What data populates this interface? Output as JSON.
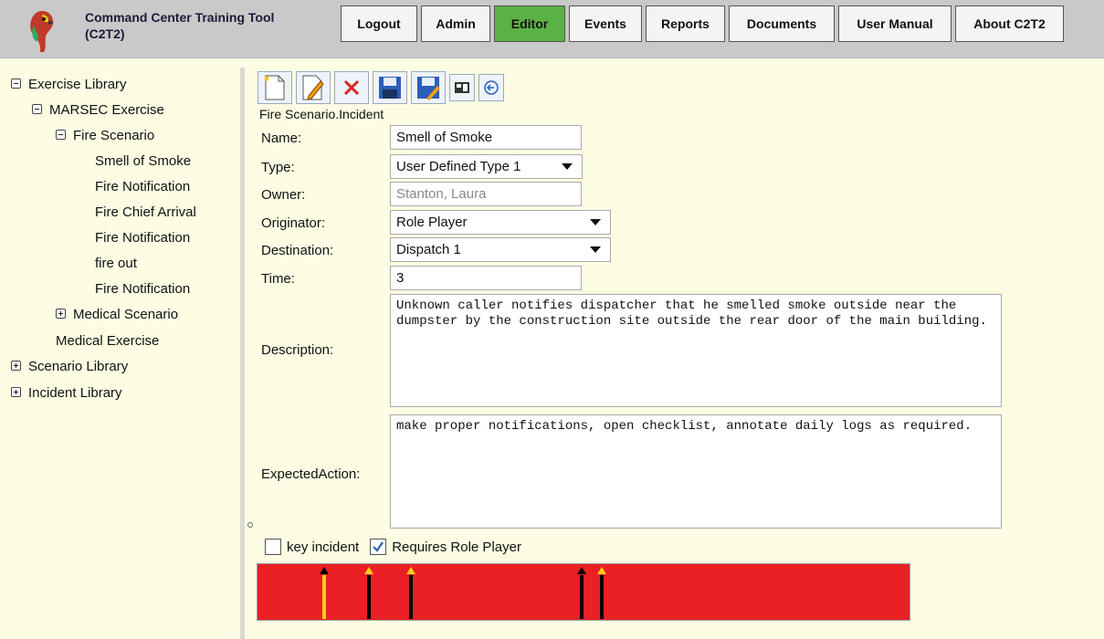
{
  "header": {
    "app_title": "Command Center Training Tool (C2T2)",
    "nav": [
      {
        "label": "Logout",
        "active": false
      },
      {
        "label": "Admin",
        "active": false
      },
      {
        "label": "Editor",
        "active": true
      },
      {
        "label": "Events",
        "active": false
      },
      {
        "label": "Reports",
        "active": false
      },
      {
        "label": "Documents",
        "active": false
      },
      {
        "label": "User Manual",
        "active": false
      },
      {
        "label": "About C2T2",
        "active": false
      }
    ]
  },
  "tree": {
    "exercise_library": "Exercise Library",
    "marsec_exercise": "MARSEC Exercise",
    "fire_scenario": "Fire Scenario",
    "fire_items": [
      "Smell of Smoke",
      "Fire Notification",
      "Fire Chief Arrival",
      "Fire Notification",
      "fire out",
      "Fire Notification"
    ],
    "medical_scenario": "Medical Scenario",
    "medical_exercise": "Medical Exercise",
    "scenario_library": "Scenario Library",
    "incident_library": "Incident Library"
  },
  "toolbar": {
    "icons": [
      "new-document-icon",
      "edit-icon",
      "delete-icon",
      "save-icon",
      "save-as-icon",
      "export-icon",
      "back-icon"
    ]
  },
  "form": {
    "breadcrumb": "Fire Scenario.Incident",
    "name_label": "Name:",
    "name_value": "Smell of Smoke",
    "type_label": "Type:",
    "type_value": "User Defined Type 1",
    "owner_label": "Owner:",
    "owner_value": "Stanton, Laura",
    "originator_label": "Originator:",
    "originator_value": "Role Player",
    "destination_label": "Destination:",
    "destination_value": "Dispatch 1",
    "time_label": "Time:",
    "time_value": "3",
    "description_label": "Description:",
    "description_value": "Unknown caller notifies dispatcher that he smelled smoke outside near the dumpster by the construction site outside the rear door of the main building.",
    "expected_label": "ExpectedAction:",
    "expected_value": "make proper notifications, open checklist, annotate daily logs as required.",
    "key_incident_label": "key incident",
    "key_incident_checked": false,
    "requires_role_player_label": "Requires Role Player",
    "requires_role_player_checked": true
  },
  "colors": {
    "timeline_bg": "#ea2024",
    "marker_yellow": "#ffcc1a",
    "marker_black": "#000000",
    "active_nav": "#5bb244"
  }
}
